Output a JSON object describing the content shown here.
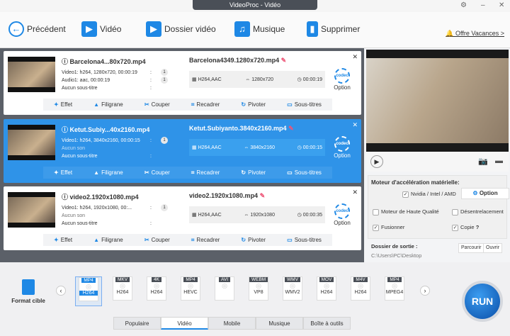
{
  "window": {
    "title": "VideoProc - Vidéo"
  },
  "toolbar": {
    "back": "Précédent",
    "video": "Vidéo",
    "folder": "Dossier vidéo",
    "music": "Musique",
    "delete": "Supprimer",
    "promo": "Offre Vacances >"
  },
  "files": [
    {
      "src_name": "Barcelona4...80x720.mp4",
      "video": "Video1: h264, 1280x720, 00:00:19",
      "audio": "Audio1: aac, 00:00:19",
      "subtitle": "Aucun sous-titre",
      "video_track": "1",
      "audio_track": "1",
      "dst_name": "Barcelona4349.1280x720.mp4",
      "codec": "H264,AAC",
      "resolution": "1280x720",
      "duration": "00:00:19",
      "selected": false
    },
    {
      "src_name": "Ketut.Subiy...40x2160.mp4",
      "video": "Video1: h264, 3840x2160, 00:00:15",
      "audio": "Aucun son",
      "subtitle": "Aucun sous-titre",
      "video_track": "1",
      "audio_track": "",
      "dst_name": "Ketut.Subiyanto.3840x2160.mp4",
      "codec": "H264,AAC",
      "resolution": "3840x2160",
      "duration": "00:00:15",
      "selected": true
    },
    {
      "src_name": "video2.1920x1080.mp4",
      "video": "Video1: h264, 1920x1080, 00:...",
      "audio": "Aucun son",
      "subtitle": "Aucun sous-titre",
      "video_track": "1",
      "audio_track": "",
      "dst_name": "video2.1920x1080.mp4",
      "codec": "H264,AAC",
      "resolution": "1920x1080",
      "duration": "00:00:35",
      "selected": false
    }
  ],
  "card": {
    "option": "Option",
    "codec_badge": "codec",
    "actions": [
      "Effet",
      "Filigrane",
      "Couper",
      "Recadrer",
      "Pivoter",
      "Sous-titres"
    ]
  },
  "hardware": {
    "title": "Moteur d'accélération matérielle:",
    "gpu": "Nvidia / Intel / AMD",
    "option": "Option",
    "high_quality": "Moteur de Haute Qualité",
    "deinterlace": "Désentrelacement",
    "merge": "Fusionner",
    "copy": "Copie",
    "help": "?"
  },
  "output": {
    "label": "Dossier de sortie :",
    "path": "C:\\Users\\PC\\Desktop",
    "browse": "Parcourir",
    "open": "Ouvrir"
  },
  "bottom": {
    "target_label": "Format cible",
    "run": "RUN",
    "formats": [
      {
        "top": "MP4",
        "bottom": "H264"
      },
      {
        "top": "MKV",
        "bottom": "H264"
      },
      {
        "top": "4K",
        "bottom": "H264"
      },
      {
        "top": "MP4",
        "bottom": "HEVC"
      },
      {
        "top": "AVI",
        "bottom": ""
      },
      {
        "top": "WEBM",
        "bottom": "VP8"
      },
      {
        "top": "WMV",
        "bottom": "WMV2"
      },
      {
        "top": "MOV",
        "bottom": "H264"
      },
      {
        "top": "M4V",
        "bottom": "H264"
      },
      {
        "top": "MP4",
        "bottom": "MPEG4"
      }
    ],
    "tabs": [
      "Populaire",
      "Vidéo",
      "Mobile",
      "Musique",
      "Boîte à outils"
    ],
    "active_tab": "Vidéo"
  }
}
